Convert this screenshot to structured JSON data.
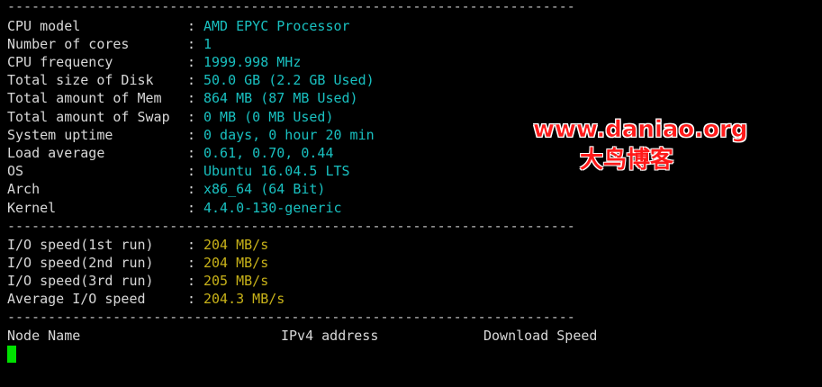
{
  "separator": "----------------------------------------------------------------------",
  "system_info": [
    {
      "label": "CPU model",
      "value": "AMD EPYC Processor"
    },
    {
      "label": "Number of cores",
      "value": "1"
    },
    {
      "label": "CPU frequency",
      "value": "1999.998 MHz"
    },
    {
      "label": "Total size of Disk",
      "value": "50.0 GB (2.2 GB Used)"
    },
    {
      "label": "Total amount of Mem",
      "value": "864 MB (87 MB Used)"
    },
    {
      "label": "Total amount of Swap",
      "value": "0 MB (0 MB Used)"
    },
    {
      "label": "System uptime",
      "value": "0 days, 0 hour 20 min"
    },
    {
      "label": "Load average",
      "value": "0.61, 0.70, 0.44"
    },
    {
      "label": "OS",
      "value": "Ubuntu 16.04.5 LTS"
    },
    {
      "label": "Arch",
      "value": "x86_64 (64 Bit)"
    },
    {
      "label": "Kernel",
      "value": "4.4.0-130-generic"
    }
  ],
  "io_info": [
    {
      "label": "I/O speed(1st run)",
      "value": "204 MB/s"
    },
    {
      "label": "I/O speed(2nd run)",
      "value": "204 MB/s"
    },
    {
      "label": "I/O speed(3rd run)",
      "value": "205 MB/s"
    },
    {
      "label": "Average I/O speed",
      "value": "204.3 MB/s"
    }
  ],
  "colon": ":",
  "speed_table": {
    "col_node": "Node Name",
    "col_ipv4": "IPv4 address",
    "col_download": "Download Speed"
  },
  "watermark": {
    "url": "www.daniao.org",
    "name": "大鸟博客"
  },
  "colors": {
    "background": "#000000",
    "label": "#d8d8d8",
    "value_cyan": "#19c0c0",
    "value_yellow": "#c8b219",
    "cursor": "#00e000",
    "watermark": "#ff1a1a"
  }
}
